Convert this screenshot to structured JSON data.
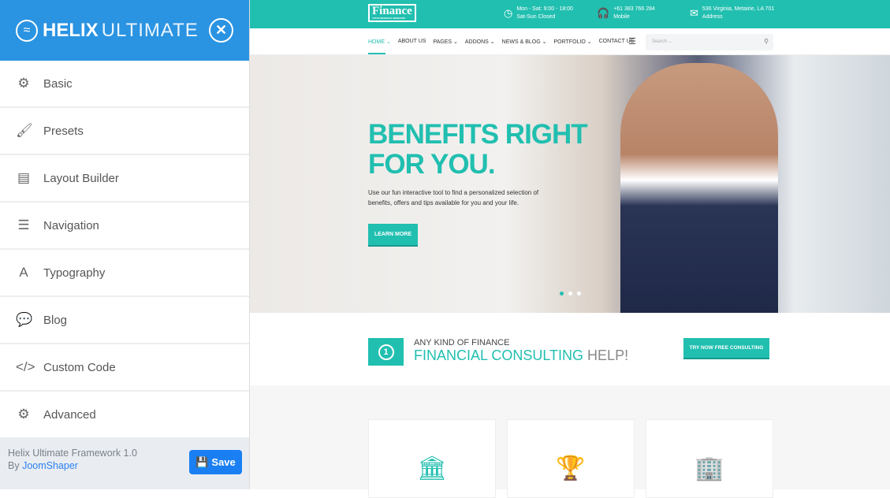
{
  "sidebar": {
    "brand_bold": "HELIX",
    "brand_light": "ULTIMATE",
    "items": [
      {
        "label": "Basic",
        "icon": "gear-icon",
        "glyph": "⚙"
      },
      {
        "label": "Presets",
        "icon": "brush-icon",
        "glyph": "🖌"
      },
      {
        "label": "Layout Builder",
        "icon": "layout-icon",
        "glyph": "▤"
      },
      {
        "label": "Navigation",
        "icon": "list-icon",
        "glyph": "☰"
      },
      {
        "label": "Typography",
        "icon": "font-icon",
        "glyph": "A"
      },
      {
        "label": "Blog",
        "icon": "comments-icon",
        "glyph": "💬"
      },
      {
        "label": "Custom Code",
        "icon": "code-icon",
        "glyph": "</>"
      },
      {
        "label": "Advanced",
        "icon": "gear-icon",
        "glyph": "⚙"
      }
    ],
    "footer": {
      "version": "Helix Ultimate Framework 1.0",
      "by": "By",
      "author": "JoomShaper",
      "save": "Save"
    }
  },
  "site": {
    "logo": "Finance",
    "logo_tag": "YOUR FINANCIAL MANAGER",
    "info": [
      {
        "icon": "clock-icon",
        "glyph": "◷",
        "line1": "Mon - Sat: 9:00 - 18:00",
        "line2": "Sat-Sun Closed"
      },
      {
        "icon": "headphones-icon",
        "glyph": "🎧",
        "line1": "+61 383 766 284",
        "line2": "Mobile"
      },
      {
        "icon": "envelope-icon",
        "glyph": "✉",
        "line1": "536 Virginia, Metairie, LA 701",
        "line2": "Address"
      }
    ],
    "menu": [
      "HOME ⌄",
      "ABOUT US",
      "PAGES ⌄",
      "ADDONS ⌄",
      "NEWS & BLOG ⌄",
      "PORTFOLIO ⌄",
      "CONTACT US"
    ],
    "search_placeholder": "Search ...",
    "hero": {
      "title1": "BENEFITS RIGHT",
      "title2": "FOR YOU.",
      "text": "Use our fun interactive tool to find a personalized selection of benefits, offers and tips available for you and your life.",
      "button": "LEARN MORE",
      "active_slide": 1,
      "slides": 3
    },
    "cta": {
      "line1": "ANY KIND OF FINANCE",
      "line2a": "FINANCIAL CONSULTING",
      "line2b": "HELP!",
      "button": "TRY NOW FREE CONSULTING"
    },
    "cards": [
      {
        "icon": "bank-icon",
        "glyph": "🏛"
      },
      {
        "icon": "trophy-icon",
        "glyph": "🏆"
      },
      {
        "icon": "building-icon",
        "glyph": "🏢"
      }
    ],
    "accent": "#21bfb0",
    "sidebar_accent": "#2a93e2"
  }
}
